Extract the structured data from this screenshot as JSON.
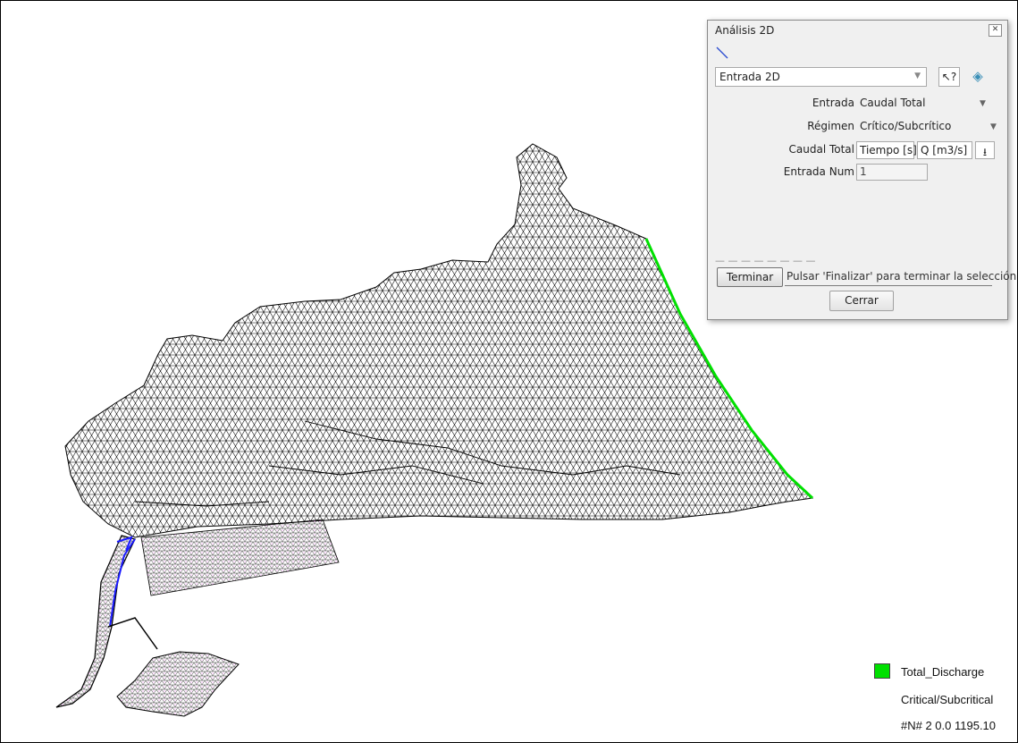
{
  "dialog": {
    "title": "Análisis 2D",
    "layer_select": "Entrada 2D",
    "rows": [
      {
        "label": "Entrada",
        "value": "Caudal Total"
      },
      {
        "label": "Régimen",
        "value": "Crítico/Subcrítico"
      }
    ],
    "caudal_total_label": "Caudal Total",
    "table_headers": [
      "Tiempo [s]",
      "Q [m3/s]"
    ],
    "entrada_num_label": "Entrada Num",
    "entrada_num_value": "1",
    "terminar_label": "Terminar",
    "status_message": "Pulsar 'Finalizar' para terminar la selección",
    "cerrar_label": "Cerrar"
  },
  "legend": {
    "swatch_color": "#00e000",
    "entries": [
      "Total_Discharge",
      "Critical/Subcritical",
      "#N# 2 0.0 1195.10"
    ]
  },
  "colors": {
    "mesh": "#000000",
    "boundary_highlight": "#00e000",
    "channel": "#1a1aff",
    "mesh_fill_pink": "#ff77ff"
  },
  "icons": [
    "line-tool-icon",
    "close-icon",
    "help-pointer-icon",
    "layers-icon",
    "import-table-icon",
    "dropdown-arrow-icon"
  ]
}
